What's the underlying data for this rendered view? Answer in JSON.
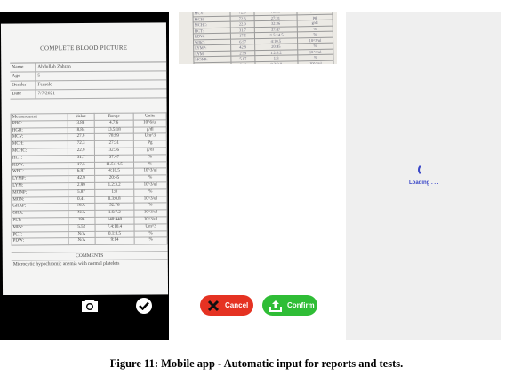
{
  "report": {
    "title": "COMPLETE BLOOD PICTURE",
    "header_rows": [
      {
        "key": "Name",
        "value": "Abdullah Zahran"
      },
      {
        "key": "Age",
        "value": "5"
      },
      {
        "key": "Gender",
        "value": "Female"
      },
      {
        "key": "Date",
        "value": "7/7/2021"
      }
    ],
    "columns": [
      "Measurement",
      "Value",
      "Range",
      "Units"
    ],
    "rows": [
      [
        "RBC:",
        "3.86",
        "4.7:6",
        "10^6/ul"
      ],
      [
        "HGB:",
        "8.84",
        "13.5:18",
        "g/dl"
      ],
      [
        "MCV:",
        "27.9",
        "78:99",
        "Um^3"
      ],
      [
        "MCH:",
        "72.3",
        "27:31",
        "Pg"
      ],
      [
        "MCHC:",
        "22.9",
        "32:36",
        "g/dl"
      ],
      [
        "HCT:",
        "31.7",
        "37:47",
        "%"
      ],
      [
        "RDW:",
        "17.5",
        "11.5:14.5",
        "%"
      ],
      [
        "WBC:",
        "6.97",
        "4:10.5",
        "10^3/ul"
      ],
      [
        "LYMP:",
        "42.9",
        "20:45",
        "%"
      ],
      [
        "LYM:",
        "2.99",
        "1.2:3.2",
        "10^3/ul"
      ],
      [
        "MONP:",
        "5.87",
        "1:8",
        "%"
      ],
      [
        "MON:",
        "0.41",
        "0.3:0.8",
        "10^3/ul"
      ],
      [
        "GRAP:",
        "N/A",
        "52:76",
        "%"
      ],
      [
        "GRA:",
        "N/A",
        "1.6:7.2",
        "10^3/ul"
      ],
      [
        "PLT:",
        "186",
        "140:440",
        "10^3/ul"
      ],
      [
        "MPV:",
        "5.52",
        "7.4:10.4",
        "Um^3"
      ],
      [
        "PCT:",
        "N/A",
        "0.1:0.5",
        "%"
      ],
      [
        "PDW:",
        "N/A",
        "9:14",
        "%"
      ]
    ],
    "comments_title": "COMMENTS",
    "comments_text": "Microcytic hypochromic anemia with normal platelets"
  },
  "crop_rows": [
    [
      "MCV:",
      "72.3",
      "78:99",
      "Um^3"
    ],
    [
      "MCH:",
      "72.3",
      "27:31",
      "pg"
    ],
    [
      "MCHC:",
      "22.9",
      "32:36",
      "g/dl"
    ],
    [
      "HCT:",
      "31.7",
      "37:47",
      "%"
    ],
    [
      "RDW:",
      "17.5",
      "11.5:14.5",
      "%"
    ],
    [
      "WBC:",
      "6.97",
      "4:10.5",
      "10^3/ul"
    ],
    [
      "LYMP:",
      "42.9",
      "20:45",
      "%"
    ],
    [
      "LYM:",
      "2.99",
      "1.2:3.2",
      "10^3/ul"
    ],
    [
      "MONP:",
      "5.87",
      "1:8",
      "%"
    ],
    [
      "MON:",
      "0.41",
      "0.3:0.8",
      "10^3/ul"
    ]
  ],
  "buttons": {
    "cancel": "Cancel",
    "confirm": "Confirm"
  },
  "loading": "Loading . . .",
  "caption": "Figure 11: Mobile app - Automatic input for reports and tests.",
  "colors": {
    "cancel": "#e53222",
    "confirm": "#2fbd36",
    "spinner": "#3a47c8"
  },
  "icons": {
    "capture": "camera-icon",
    "accept": "check-circle-icon",
    "cancel": "x-icon",
    "confirm": "upload-icon"
  }
}
